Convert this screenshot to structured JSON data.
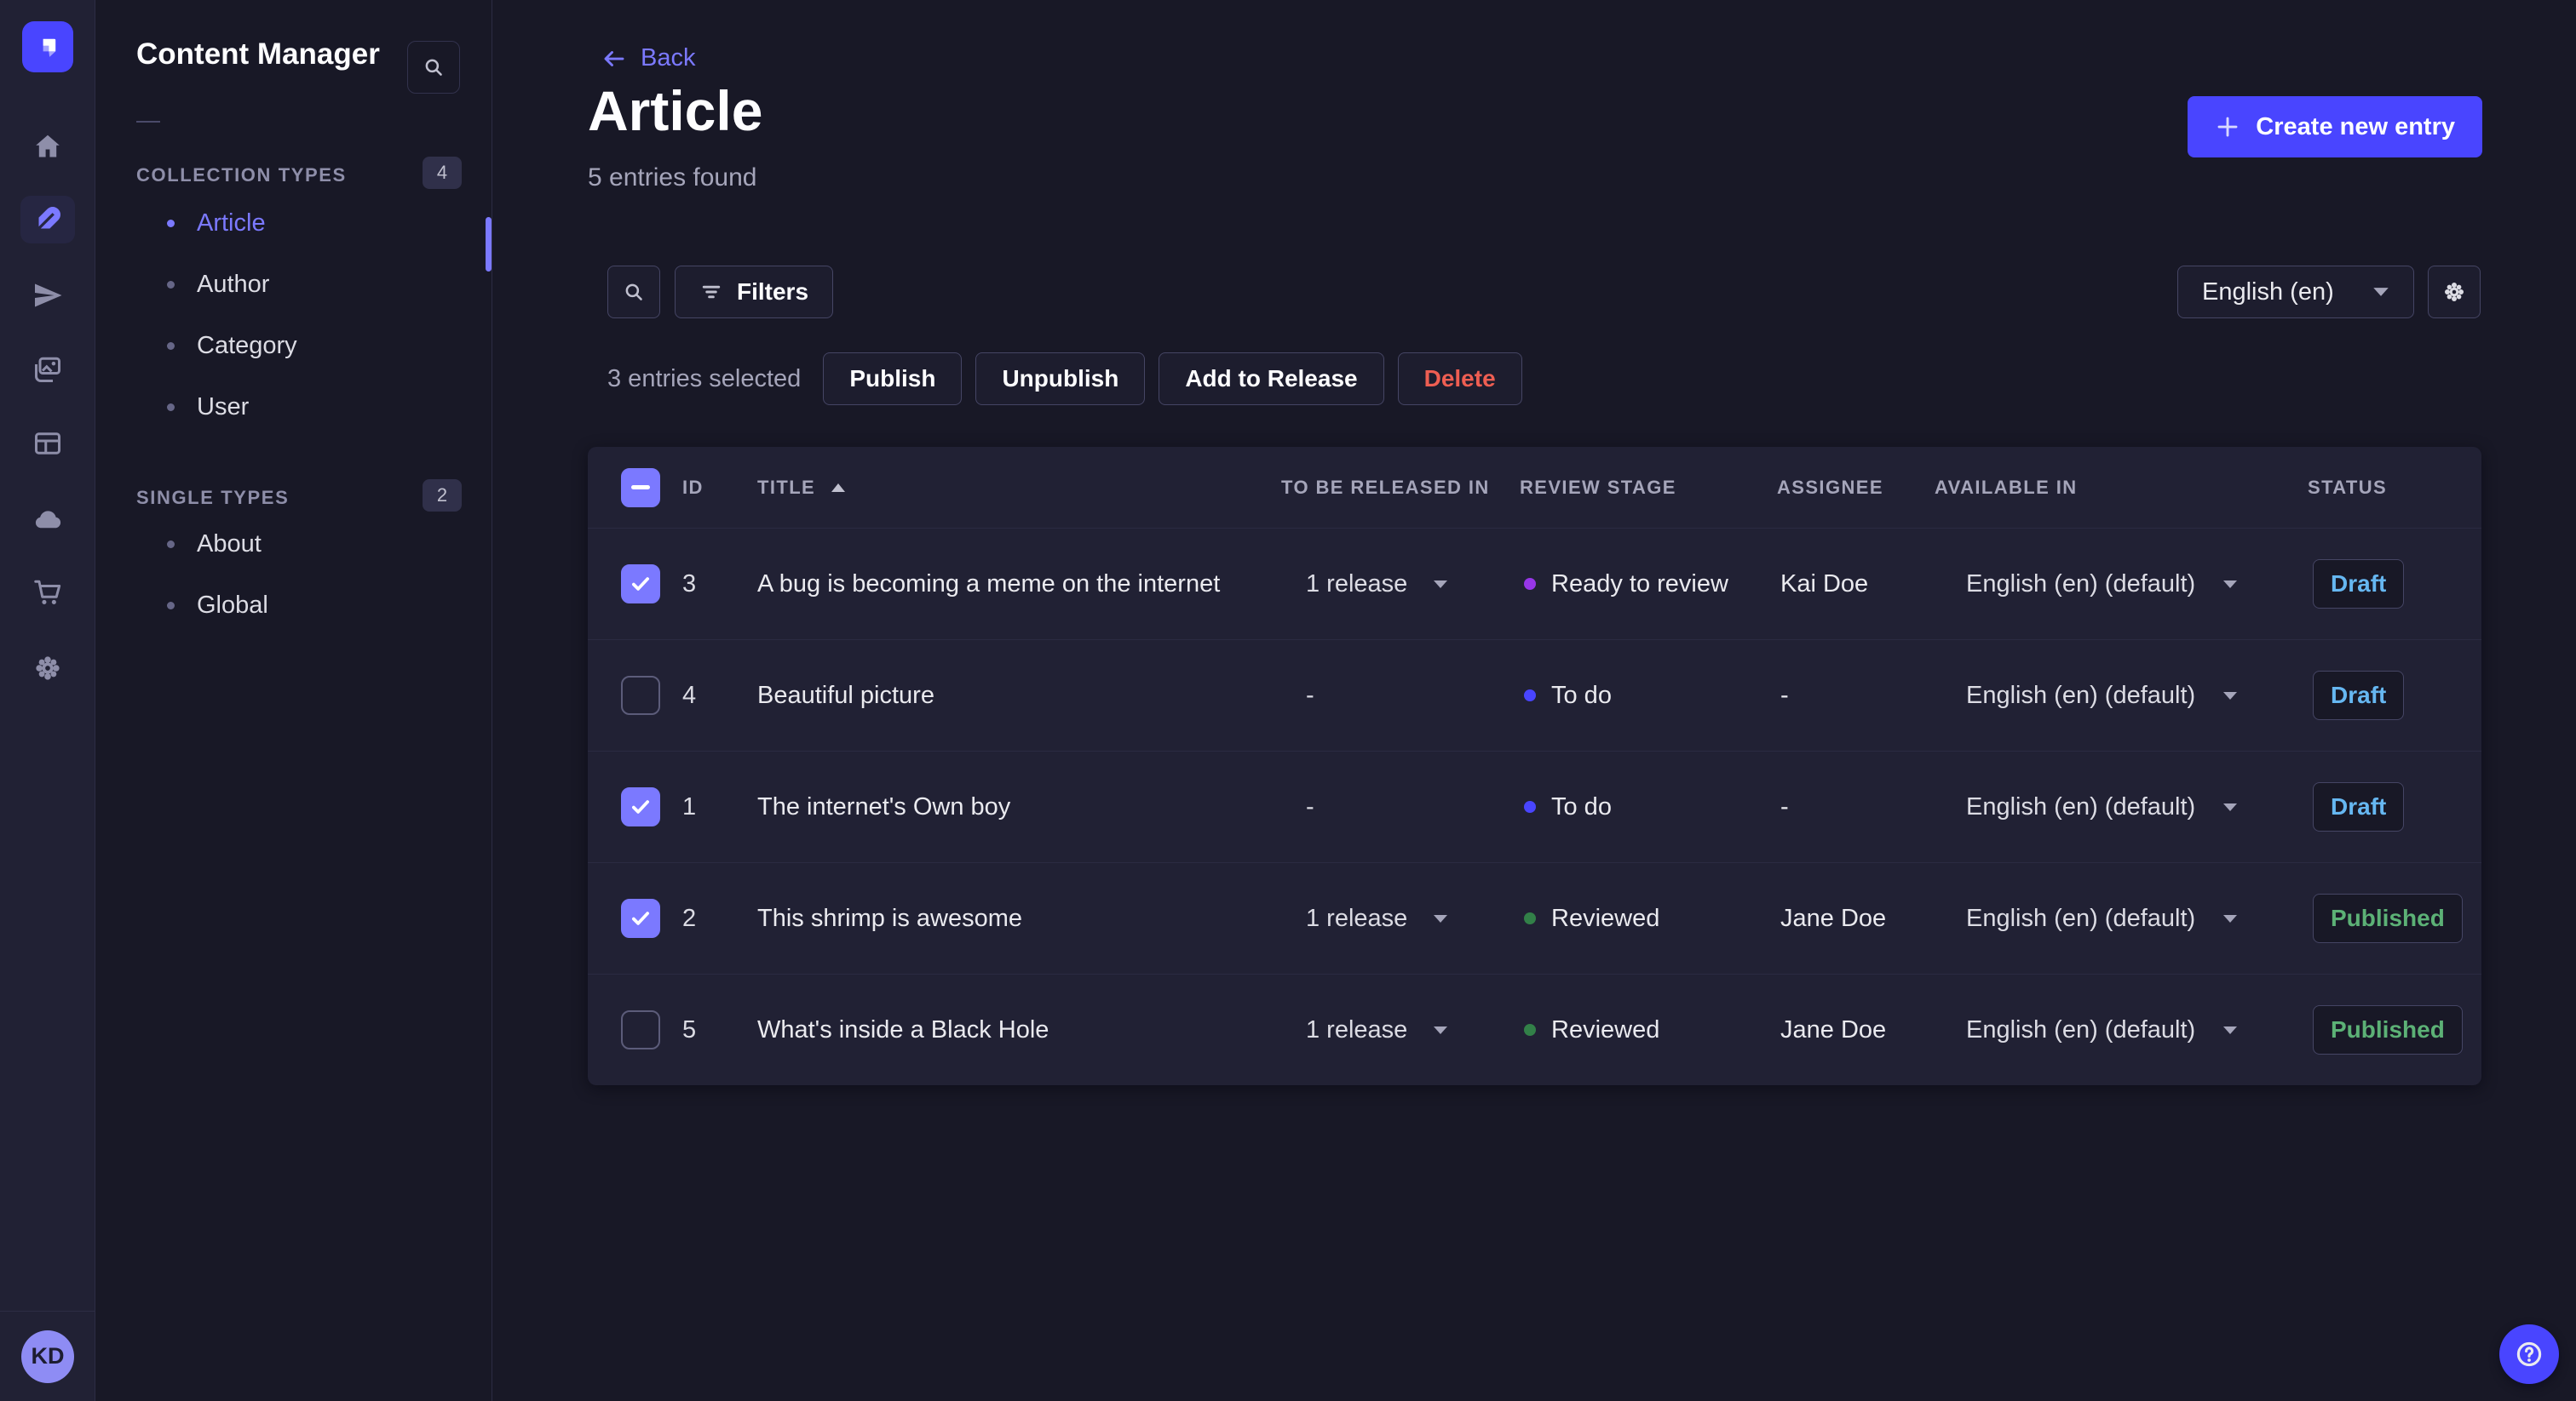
{
  "rail": {
    "logo_icon": "strapi-logo",
    "icons": [
      "home-icon",
      "content-manager-icon",
      "releases-icon",
      "media-library-icon",
      "content-type-builder-icon",
      "cloud-icon",
      "marketplace-icon",
      "settings-icon"
    ],
    "active_icon": "content-manager-icon",
    "avatar_initials": "KD",
    "help_icon": "question-mark-icon"
  },
  "subnav": {
    "title": "Content Manager",
    "search_icon": "search-icon",
    "sections": [
      {
        "label": "COLLECTION TYPES",
        "badge": "4",
        "items": [
          {
            "label": "Article",
            "active": true
          },
          {
            "label": "Author",
            "active": false
          },
          {
            "label": "Category",
            "active": false
          },
          {
            "label": "User",
            "active": false
          }
        ]
      },
      {
        "label": "SINGLE TYPES",
        "badge": "2",
        "items": [
          {
            "label": "About",
            "active": false
          },
          {
            "label": "Global",
            "active": false
          }
        ]
      }
    ]
  },
  "header": {
    "back_label": "Back",
    "title": "Article",
    "subtitle": "5 entries found",
    "create_button": "Create new entry"
  },
  "toolbar": {
    "filters_button": "Filters",
    "locale_value": "English (en)"
  },
  "selection": {
    "label": "3 entries selected",
    "actions": [
      {
        "label": "Publish",
        "danger": false
      },
      {
        "label": "Unpublish",
        "danger": false
      },
      {
        "label": "Add to Release",
        "danger": false
      },
      {
        "label": "Delete",
        "danger": true
      }
    ]
  },
  "table": {
    "headers": {
      "id": "ID",
      "title": "TITLE",
      "release": "TO BE RELEASED IN",
      "stage": "REVIEW STAGE",
      "assignee": "ASSIGNEE",
      "available": "AVAILABLE IN",
      "status": "STATUS"
    },
    "rows": [
      {
        "checked": true,
        "id": "3",
        "title": "A bug is becoming a meme on the internet",
        "release": "1 release",
        "stage": {
          "label": "Ready to review",
          "color": "#9736e8"
        },
        "assignee": "Kai Doe",
        "available": "English (en) (default)",
        "status": {
          "label": "Draft",
          "color": "#66b7f1"
        }
      },
      {
        "checked": false,
        "id": "4",
        "title": "Beautiful picture",
        "release": "-",
        "stage": {
          "label": "To do",
          "color": "#4945ff"
        },
        "assignee": "-",
        "available": "English (en) (default)",
        "status": {
          "label": "Draft",
          "color": "#66b7f1"
        }
      },
      {
        "checked": true,
        "id": "1",
        "title": "The internet's Own boy",
        "release": "-",
        "stage": {
          "label": "To do",
          "color": "#4945ff"
        },
        "assignee": "-",
        "available": "English (en) (default)",
        "status": {
          "label": "Draft",
          "color": "#66b7f1"
        }
      },
      {
        "checked": true,
        "id": "2",
        "title": "This shrimp is awesome",
        "release": "1 release",
        "stage": {
          "label": "Reviewed",
          "color": "#328048"
        },
        "assignee": "Jane Doe",
        "available": "English (en) (default)",
        "status": {
          "label": "Published",
          "color": "#5cb176"
        }
      },
      {
        "checked": false,
        "id": "5",
        "title": "What's inside a Black Hole",
        "release": "1 release",
        "stage": {
          "label": "Reviewed",
          "color": "#328048"
        },
        "assignee": "Jane Doe",
        "available": "English (en) (default)",
        "status": {
          "label": "Published",
          "color": "#5cb176"
        }
      }
    ]
  },
  "colors": {
    "primary": "#4945ff",
    "link": "#7b79ff",
    "page_bg": "#181826",
    "surface_bg": "#212134",
    "draft": "#66b7f1",
    "published": "#5cb176",
    "danger": "#ee5e52",
    "stage_todo": "#4945ff",
    "stage_ready_to_review": "#9736e8",
    "stage_reviewed": "#328048"
  }
}
